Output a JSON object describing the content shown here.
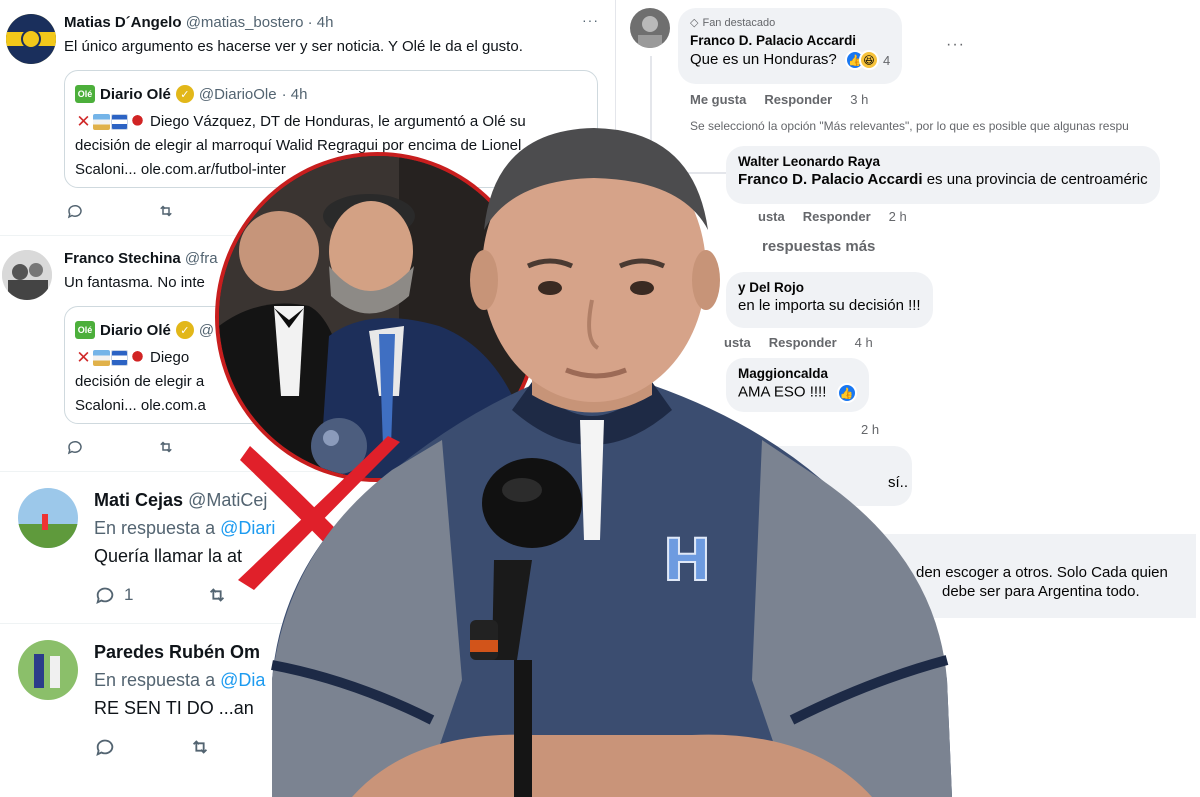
{
  "twitter": {
    "tweets": [
      {
        "name": "Matias D´Angelo",
        "handle": "@matias_bostero",
        "time": "· 4h",
        "text": "El único argumento es hacerse ver y ser noticia. Y Olé le da el gusto.",
        "quote": {
          "name": "Diario Olé",
          "handle": "@DiarioOle",
          "time": "· 4h",
          "line1": "Diego Vázquez, DT de Honduras, le argumentó a Olé su",
          "line2": "decisión de elegir al marroquí Walid Regragui por encima de Lionel",
          "line3": "Scaloni... ole.com.ar/futbol-inter"
        }
      },
      {
        "name": "Franco Stechina",
        "handle": "@fra",
        "text": "Un fantasma. No inte",
        "quote": {
          "name": "Diario Olé",
          "handle": "@",
          "line1": "Diego",
          "line2": "decisión de elegir a",
          "line3": "Scaloni... ole.com.a"
        }
      },
      {
        "name": "Mati Cejas",
        "handle": "@MatiCej",
        "reply_prefix": "En respuesta a",
        "reply_to": "@Diari",
        "text": "Quería llamar la at",
        "reply_count": "1"
      },
      {
        "name": "Paredes Rubén Om",
        "reply_prefix": "En respuesta a",
        "reply_to": "@Dia",
        "text": "RE SEN TI DO ...an"
      }
    ]
  },
  "facebook": {
    "top_comment": {
      "badge": "Fan destacado",
      "name": "Franco D. Palacio Accardi",
      "text": "Que es un Honduras?",
      "reaction_count": "4",
      "like_label": "Me gusta",
      "reply_label": "Responder",
      "time": "3 h"
    },
    "relevance_note": "Se seleccionó la opción \"Más relevantes\", por lo que es posible que algunas respu",
    "replies": [
      {
        "name": "Walter Leonardo Raya",
        "mention": "Franco D. Palacio Accardi",
        "text": "es una provincia de centroaméric",
        "like_label": "usta",
        "reply_label": "Responder",
        "time": "2 h"
      },
      {
        "more_label": "respuestas más"
      },
      {
        "name": "y Del Rojo",
        "text": "en le importa su decisión !!!",
        "like_label": "usta",
        "reply_label": "Responder",
        "time": "4 h"
      },
      {
        "name": "Maggioncalda",
        "text": "AMA ESO !!!!",
        "time": "2 h"
      },
      {
        "text": "sí.."
      },
      {
        "line1": "den escoger a otros. Solo Cada quien",
        "line2": "debe ser para Argentina todo."
      }
    ]
  },
  "colors": {
    "twitter_link": "#1d9bf0",
    "twitter_muted": "#536471",
    "facebook_bubble": "#f0f2f5",
    "facebook_blue": "#1877f2",
    "red_x": "#e0202a",
    "coach_shirt": "#3b4d70"
  },
  "icons": [
    "more-icon",
    "reply-icon",
    "retweet-icon",
    "share-icon",
    "verified-icon",
    "diamond-icon",
    "like-reaction-icon",
    "haha-reaction-icon",
    "microphone-icon"
  ]
}
